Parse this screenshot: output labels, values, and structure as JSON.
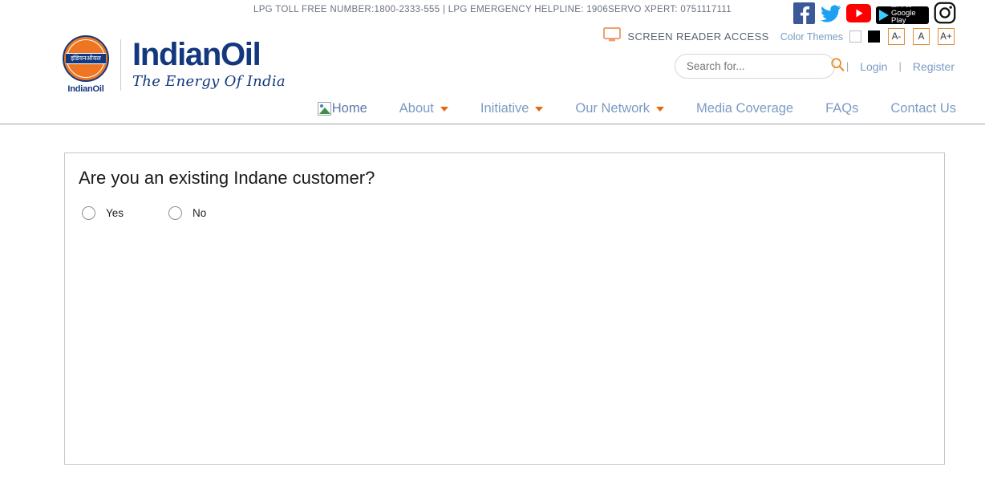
{
  "topbar": {
    "helpline": "LPG TOLL FREE NUMBER:1800-2333-555 | LPG EMERGENCY HELPLINE: 1906SERVO XPERT: 0751117111",
    "social": [
      {
        "name": "facebook-icon",
        "label": "Facebook"
      },
      {
        "name": "twitter-icon",
        "label": "Twitter"
      },
      {
        "name": "youtube-icon",
        "label": "YouTube"
      },
      {
        "name": "google-play-badge",
        "top_label": "GET IT ON",
        "main_label": "Google Play"
      },
      {
        "name": "instagram-icon",
        "label": "Instagram"
      }
    ]
  },
  "accessibility": {
    "screen_reader_label": "SCREEN READER ACCESS",
    "color_themes_label": "Color Themes",
    "swatches": [
      "#ffffff",
      "#000000"
    ],
    "font_sizes": [
      "A-",
      "A",
      "A+"
    ]
  },
  "logo": {
    "hindi_text": "इंडियनऑयल",
    "mark_caption": "IndianOil",
    "wordmark": "IndianOil",
    "tagline": "The Energy Of India",
    "brand_blue": "#13387e",
    "brand_orange": "#ee7622"
  },
  "search": {
    "placeholder": "Search for...",
    "value": "",
    "icon": "search-icon",
    "divider": "|"
  },
  "account": {
    "login_label": "Login",
    "register_label": "Register",
    "divider": "|"
  },
  "nav": {
    "items": [
      {
        "label": "Home",
        "has_caret": false,
        "broken_image": true
      },
      {
        "label": "About",
        "has_caret": true,
        "broken_image": false
      },
      {
        "label": "Initiative",
        "has_caret": true,
        "broken_image": false
      },
      {
        "label": "Our Network",
        "has_caret": true,
        "broken_image": false
      },
      {
        "label": "Media Coverage",
        "has_caret": false,
        "broken_image": false
      },
      {
        "label": "FAQs",
        "has_caret": false,
        "broken_image": false
      },
      {
        "label": "Contact Us",
        "has_caret": false,
        "broken_image": false
      }
    ]
  },
  "main": {
    "question": "Are you an existing Indane customer?",
    "options": [
      {
        "label": "Yes",
        "selected": false
      },
      {
        "label": "No",
        "selected": false
      }
    ]
  }
}
